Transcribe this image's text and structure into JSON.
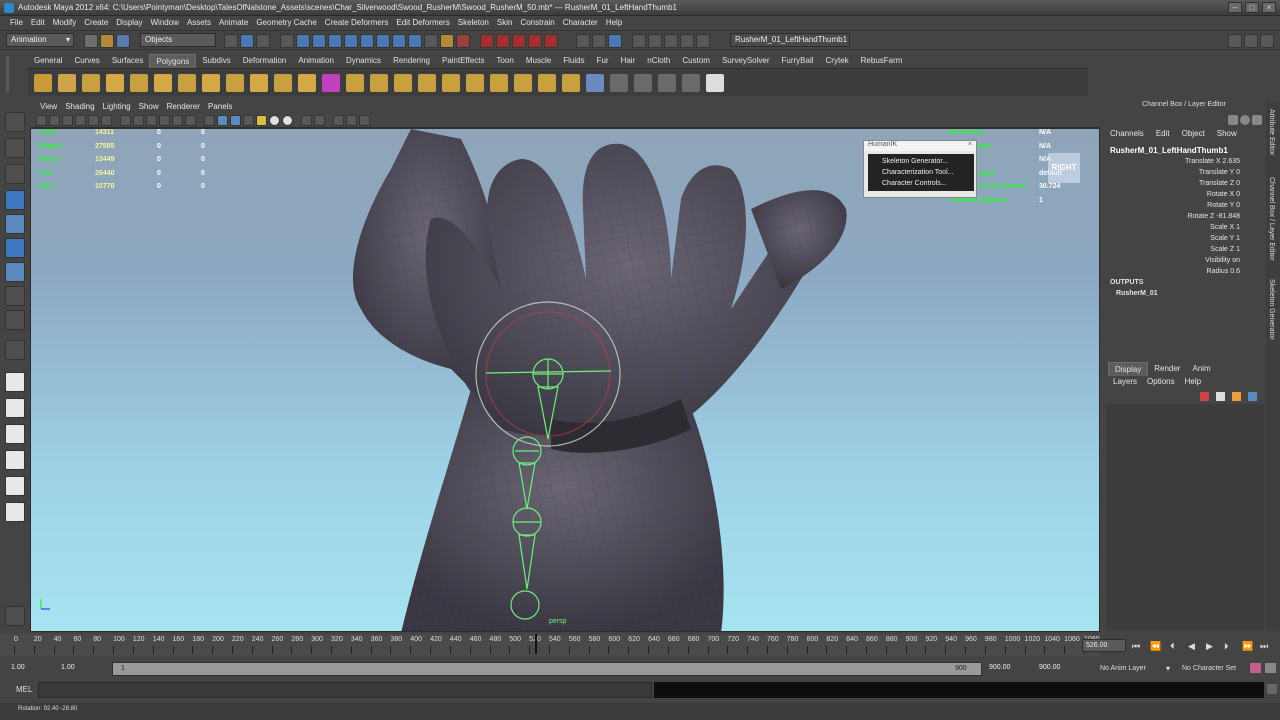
{
  "window": {
    "title": "Autodesk Maya 2012 x64: C:\\Users\\Pointyman\\Desktop\\TalesOfNalstone_Assets\\scenes\\Char_Silverwood\\Swood_RusherM\\Swood_RusherM_50.mb*   ---   RusherM_01_LeftHandThumb1"
  },
  "menubar": [
    "File",
    "Edit",
    "Modify",
    "Create",
    "Display",
    "Window",
    "Assets",
    "Animate",
    "Geometry Cache",
    "Create Deformers",
    "Edit Deformers",
    "Skeleton",
    "Skin",
    "Constrain",
    "Character",
    "Help"
  ],
  "statusline": {
    "menuset": "Animation",
    "selection_mode": "Objects",
    "selected_name": "RusherM_01_LeftHandThumb1"
  },
  "shelf": {
    "tabs": [
      "General",
      "Curves",
      "Surfaces",
      "Polygons",
      "Subdivs",
      "Deformation",
      "Animation",
      "Dynamics",
      "Rendering",
      "PaintEffects",
      "Toon",
      "Muscle",
      "Fluids",
      "Fur",
      "Hair",
      "nCloth",
      "Custom",
      "SurveySolver",
      "FurryBall",
      "Crytek",
      "RebusFarm"
    ],
    "active_tab": "Polygons"
  },
  "viewport": {
    "menus": [
      "View",
      "Shading",
      "Lighting",
      "Show",
      "Renderer",
      "Panels"
    ],
    "hud_left": [
      {
        "label": "Verts:",
        "v1": "14311",
        "v2": "0",
        "v3": "0"
      },
      {
        "label": "Edges:",
        "v1": "27585",
        "v2": "0",
        "v3": "0"
      },
      {
        "label": "Faces:",
        "v1": "13449",
        "v2": "0",
        "v3": "0"
      },
      {
        "label": "Tris:",
        "v1": "26440",
        "v2": "0",
        "v3": "0"
      },
      {
        "label": "UVs:",
        "v1": "10770",
        "v2": "0",
        "v3": "0"
      }
    ],
    "hud_right": [
      {
        "label": "Backfaces:",
        "value": "N/A"
      },
      {
        "label": "Smoothness:",
        "value": "N/A"
      },
      {
        "label": "Instance:",
        "value": "N/A"
      },
      {
        "label": "Display Layer:",
        "value": "default"
      },
      {
        "label": "Distance From Camera:",
        "value": "30.724"
      },
      {
        "label": "Selected Objects:",
        "value": "1"
      }
    ],
    "view_label": "RIGHT",
    "camera_label": "persp"
  },
  "humanik": {
    "title": "HumanIK",
    "items": [
      "Skeleton Generator...",
      "Characterization Tool...",
      "Character Controls..."
    ]
  },
  "channelbox": {
    "header": "Channel Box / Layer Editor",
    "menus": [
      "Channels",
      "Edit",
      "Object",
      "Show"
    ],
    "object_name": "RusherM_01_LeftHandThumb1",
    "attributes": [
      "Translate X 2.635",
      "Translate Y 0",
      "Translate Z 0",
      "Rotate X 0",
      "Rotate Y 0",
      "Rotate Z -81.848",
      "Scale X 1",
      "Scale Y 1",
      "Scale Z 1",
      "Visibility on",
      "Radius 0.6"
    ],
    "outputs_label": "OUTPUTS",
    "outputs_item": "RusherM_01"
  },
  "side_tabs": [
    "Attribute Editor",
    "Channel Box / Layer Editor",
    "Skeleton Generator"
  ],
  "layers": {
    "tabs": [
      "Display",
      "Render",
      "Anim"
    ],
    "active_tab": "Display",
    "menus": [
      "Layers",
      "Options",
      "Help"
    ]
  },
  "timeline": {
    "ticks": [
      "0",
      "20",
      "40",
      "60",
      "80",
      "100",
      "120",
      "140",
      "160",
      "180",
      "200",
      "220",
      "240",
      "260",
      "280",
      "300",
      "320",
      "340",
      "360",
      "380",
      "400",
      "420",
      "440",
      "460",
      "480",
      "500",
      "520",
      "540",
      "560",
      "580",
      "600",
      "620",
      "640",
      "660",
      "680",
      "700",
      "720",
      "740",
      "760",
      "780",
      "800",
      "820",
      "840",
      "860",
      "880",
      "900",
      "920",
      "940",
      "960",
      "980",
      "1000",
      "1020",
      "1040",
      "1060",
      "1080"
    ],
    "current_frame": "526.00",
    "range_start": "1.00",
    "range_start_inner": "1.00",
    "range_marker_start": "1",
    "range_marker_end": "900",
    "range_end_inner": "900.00",
    "range_end": "900.00",
    "anim_layer": "No Anim Layer",
    "character_set": "No Character Set"
  },
  "commandline": {
    "label": "MEL"
  },
  "helpline": {
    "text": "Rotation:   92.40   -28.80"
  },
  "colors": {
    "hud_label": "#2ff03a",
    "hud_value": "#f4f4a0",
    "joint": "#6cf07a",
    "mesh_wire": "#3a3a9a"
  }
}
